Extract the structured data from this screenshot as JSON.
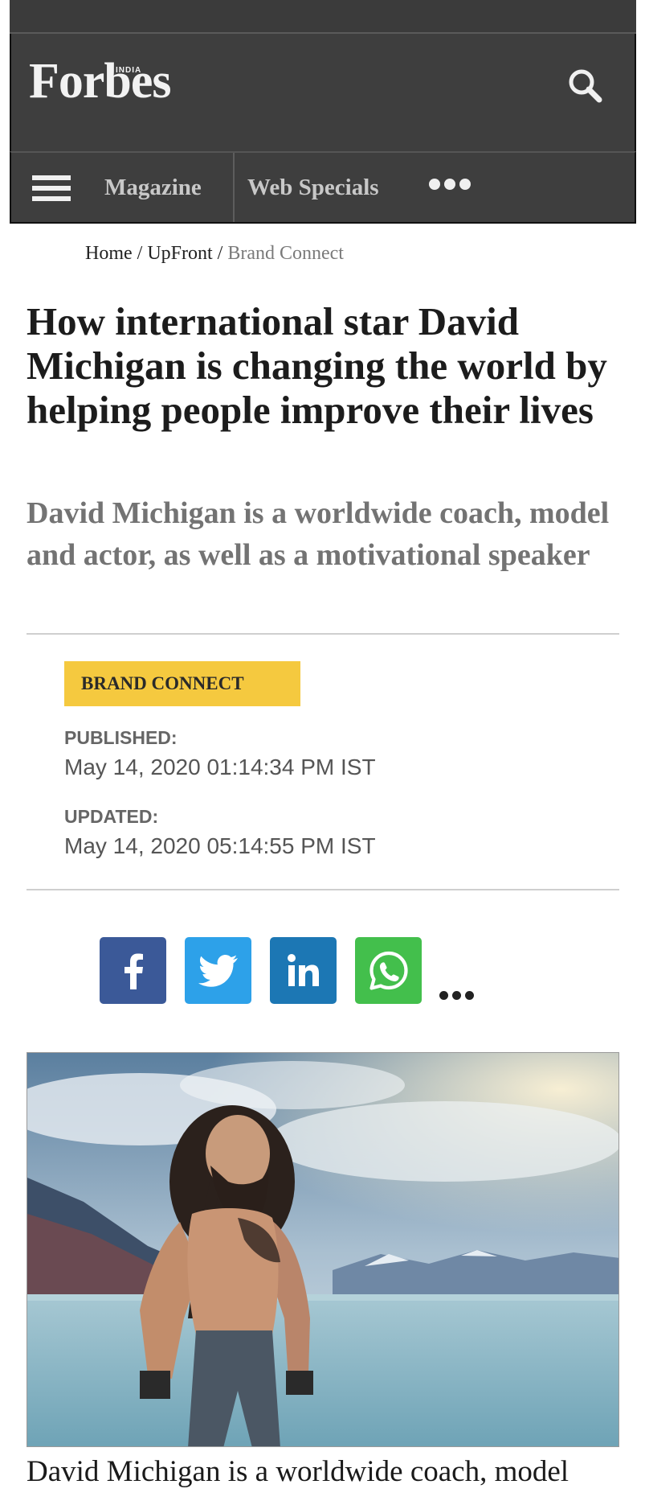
{
  "header": {
    "logo_text": "Forbes",
    "logo_superscript": "INDIA",
    "search_icon": "search-icon"
  },
  "nav": {
    "menu_icon": "hamburger-menu-icon",
    "items": [
      "Magazine",
      "Web Specials"
    ],
    "more_icon": "ellipsis-icon"
  },
  "breadcrumb": {
    "items": [
      "Home",
      "UpFront",
      "Brand Connect"
    ],
    "separator": "/"
  },
  "article": {
    "headline": "How international star David Michigan is changing the world by helping people improve their lives",
    "subheadline": "David Michigan is a worldwide coach, model and actor, as well as a motivational speaker",
    "category_tag": "BRAND CONNECT",
    "published_label": "PUBLISHED:",
    "published_value": "May 14, 2020 01:14:34 PM IST",
    "updated_label": "UPDATED:",
    "updated_value": "May 14, 2020 05:14:55 PM IST",
    "caption": "David Michigan is a worldwide coach, model"
  },
  "share": {
    "buttons": [
      {
        "name": "facebook",
        "icon": "facebook-icon",
        "color": "#3b5998"
      },
      {
        "name": "twitter",
        "icon": "twitter-icon",
        "color": "#2da1e9"
      },
      {
        "name": "linkedin",
        "icon": "linkedin-icon",
        "color": "#1c77b4"
      },
      {
        "name": "whatsapp",
        "icon": "whatsapp-icon",
        "color": "#43bf4c"
      }
    ],
    "more_icon": "ellipsis-icon"
  },
  "colors": {
    "header_bg": "#3e3e3e",
    "tag_bg": "#f5c93f",
    "subhead_text": "#737373"
  }
}
